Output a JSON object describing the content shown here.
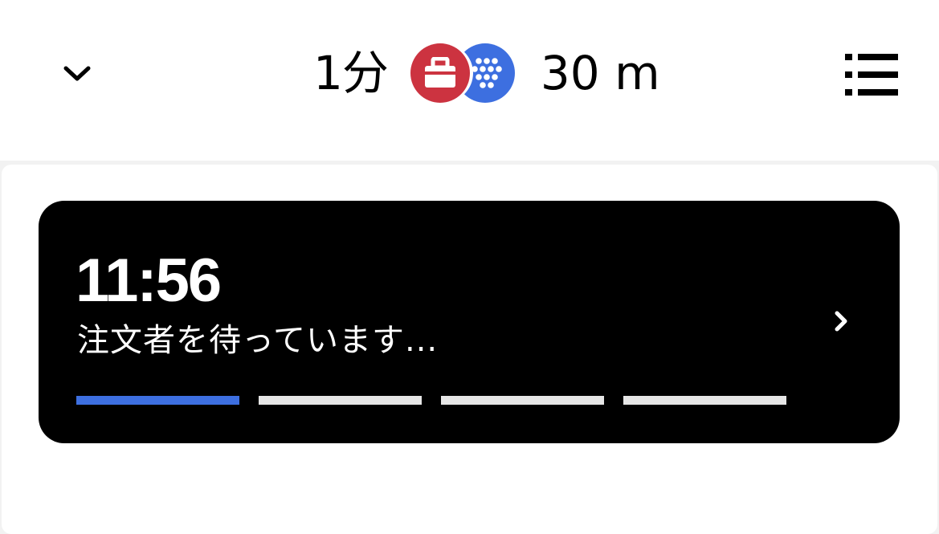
{
  "header": {
    "collapse_icon": "chevron-down-icon",
    "eta": "1分",
    "distance": "30 m",
    "menu_icon": "list-icon",
    "badges": [
      {
        "icon": "briefcase-icon",
        "color": "#cc3340"
      },
      {
        "icon": "dot-grid-icon",
        "color": "#3d6fe0"
      }
    ]
  },
  "status_card": {
    "timer": "11:56",
    "message": "注文者を待っています...",
    "chevron_icon": "chevron-right-icon",
    "progress": {
      "total_steps": 4,
      "completed_steps": 1,
      "active_color": "#3d6fe0",
      "inactive_color": "#e6e6e6"
    }
  }
}
